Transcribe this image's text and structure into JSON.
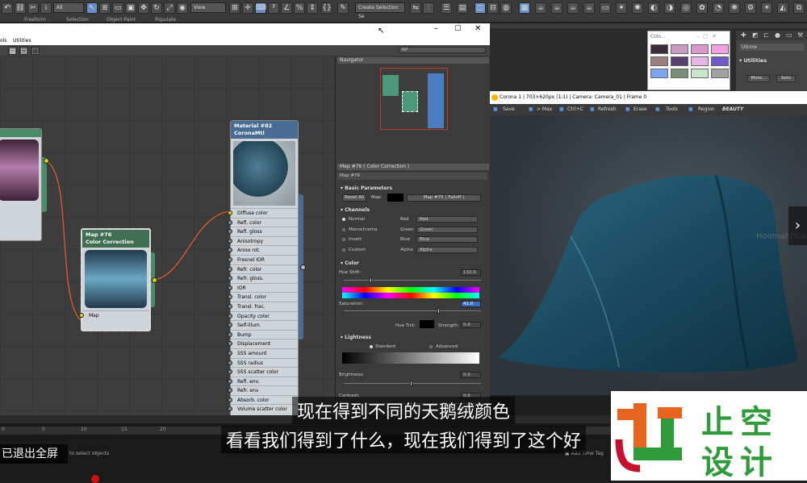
{
  "ribbon": {
    "selection_filter": "All",
    "view_dropdown": "View",
    "named_selection": "Create Selection Se",
    "tabs": [
      "Freeform",
      "Selection",
      "Object Paint",
      "Populate"
    ]
  },
  "slate": {
    "menu": [
      "ols",
      "Utilities"
    ],
    "view_dropdown": "RP",
    "navigator_title": "Navigator"
  },
  "nodes": {
    "color_correction": {
      "title": "Map #76",
      "subtitle": "Color Correction",
      "slot": "Map"
    },
    "material": {
      "title": "Material #82",
      "subtitle": "CoronaMtl",
      "slots": [
        "Diffuse color",
        "Refl. color",
        "Refl. gloss",
        "Anisotropy",
        "Aniso rot.",
        "Fresnel IOR",
        "Refr. color",
        "Refr. gloss.",
        "IOR",
        "Transl. color",
        "Transl. frac.",
        "Opacity color",
        "Self-illum.",
        "Bump",
        "Displacement",
        "SSS amount",
        "SSS radius",
        "SSS scatter color",
        "Refl. env.",
        "Refr. env",
        "Absorb. color",
        "Volume scatter color"
      ]
    }
  },
  "params": {
    "title": "Map #76  ( Color Correction )",
    "name_field": "Map #76",
    "basic": {
      "header": "Basic Parameters",
      "reset_button": "Reset All",
      "map_label": "Map:",
      "map_button": "Map #75  ( Falloff )"
    },
    "channels": {
      "header": "Channels",
      "modes": [
        "Normal",
        "Monochrome",
        "Invert",
        "Custom"
      ],
      "rows": [
        {
          "label": "Red",
          "value": "Red"
        },
        {
          "label": "Green",
          "value": "Green"
        },
        {
          "label": "Blue",
          "value": "Blue"
        },
        {
          "label": "Alpha",
          "value": "Alpha"
        }
      ]
    },
    "color": {
      "header": "Color",
      "hue_shift_label": "Hue Shift:",
      "hue_shift_value": "132.0",
      "saturation_label": "Saturation:",
      "saturation_value": "41.0",
      "hue_tint_label": "Hue Tint:",
      "strength_label": "Strength:",
      "strength_value": "0.0"
    },
    "lightness": {
      "header": "Lightness",
      "standard_label": "Standard",
      "advanced_label": "Advanced",
      "brightness_label": "Brightness:",
      "brightness_value": "0.0",
      "contrast_label": "Contrast:",
      "contrast_value": "0.0"
    }
  },
  "color_picker": {
    "title": "Colo...",
    "swatches": [
      "#3b2a3a",
      "#c99bc0",
      "#d898c9",
      "#f1a2df",
      "#9b7f7f",
      "#5a3f6e",
      "#e6b6e6",
      "#6e59c7",
      "#7da6ee",
      "#7a8f7a",
      "#c8e6c8",
      "#a0a0a0"
    ]
  },
  "command": {
    "item1": "Utilities",
    "more_button": "More...",
    "sets_button": "Sets",
    "dropdown": "Ubrow"
  },
  "render": {
    "title": "Corona 1 | 703×620px (1:1) | Camera: Camera_01 | Frame 0",
    "tools": [
      "Save",
      "> Max",
      "Ctrl+C",
      "Refresh",
      "Erase",
      "Tools",
      "Region",
      "BEAUTY"
    ]
  },
  "timeline": {
    "ticks": [
      "0",
      "5",
      "10",
      "15",
      "20"
    ],
    "status": "to select objects",
    "add_time_tag": "Add Time Tag"
  },
  "subtitles": {
    "line1": "现在得到不同的天鹅绒颜色",
    "line2": "看看我们得到了什么，现在我们得到了这个好"
  },
  "overlay": {
    "exit_fullscreen": "已退出全屏",
    "logo_text1": "止空",
    "logo_text2": "设计",
    "watermark": "HoomahPlus"
  }
}
